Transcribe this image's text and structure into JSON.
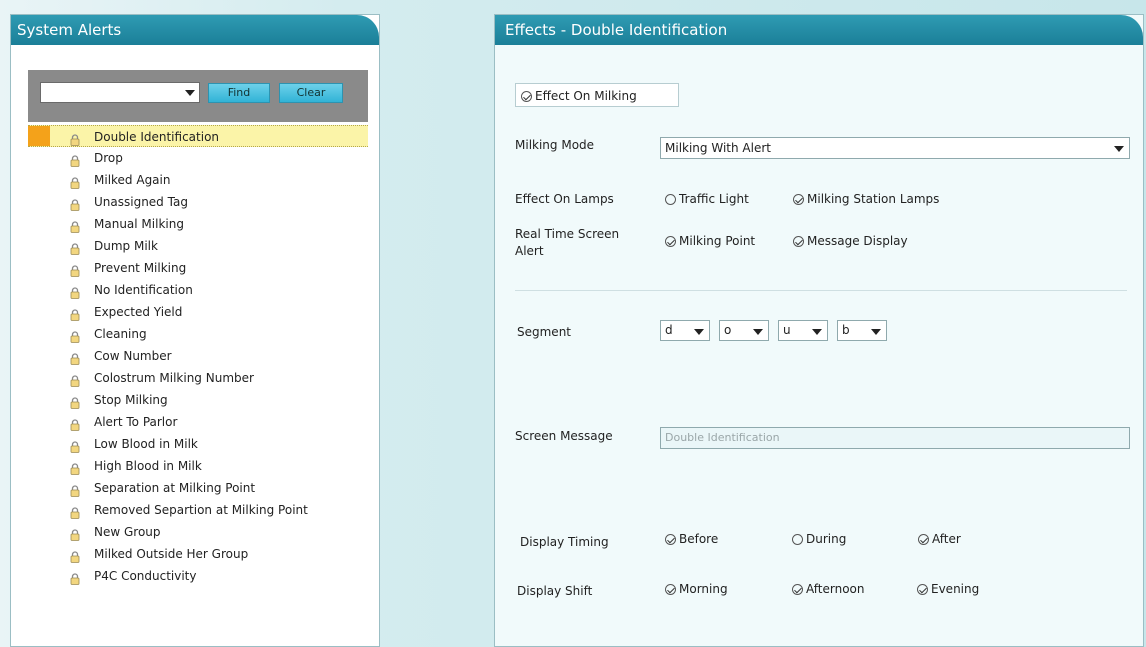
{
  "left_panel": {
    "title": "System Alerts",
    "search": {
      "value": ""
    },
    "find_label": "Find",
    "clear_label": "Clear",
    "alerts": [
      "Double Identification",
      "Drop",
      "Milked Again",
      "Unassigned Tag",
      "Manual Milking",
      "Dump Milk",
      "Prevent Milking",
      "No Identification",
      "Expected Yield",
      "Cleaning",
      "Cow Number",
      "Colostrum Milking Number",
      "Stop Milking",
      "Alert To Parlor",
      "Low Blood in Milk",
      "High Blood in Milk",
      "Separation at Milking Point",
      "Removed Separtion at Milking Point",
      "New Group",
      "Milked Outside Her Group",
      "P4C Conductivity"
    ],
    "selected_index": 0
  },
  "right_panel": {
    "title": "Effects - Double Identification",
    "effect_on_milking": {
      "label": "Effect On Milking",
      "checked": true
    },
    "milking_mode": {
      "label": "Milking Mode",
      "value": "Milking With Alert"
    },
    "effect_on_lamps": {
      "label": "Effect On Lamps",
      "traffic_light": {
        "label": "Traffic Light",
        "checked": false
      },
      "milking_station_lamps": {
        "label": "Milking Station Lamps",
        "checked": true
      }
    },
    "real_time_alert": {
      "label_line1": "Real Time Screen",
      "label_line2": "Alert",
      "milking_point": {
        "label": "Milking Point",
        "checked": true
      },
      "message_display": {
        "label": "Message Display",
        "checked": true
      }
    },
    "segment": {
      "label": "Segment",
      "values": [
        "d",
        "o",
        "u",
        "b"
      ]
    },
    "screen_message": {
      "label": "Screen Message",
      "placeholder": "Double Identification"
    },
    "display_timing": {
      "label": "Display Timing",
      "before": {
        "label": "Before",
        "checked": true
      },
      "during": {
        "label": "During",
        "checked": false
      },
      "after": {
        "label": "After",
        "checked": true
      }
    },
    "display_shift": {
      "label": "Display Shift",
      "morning": {
        "label": "Morning",
        "checked": true
      },
      "afternoon": {
        "label": "Afternoon",
        "checked": true
      },
      "evening": {
        "label": "Evening",
        "checked": true
      }
    }
  },
  "colors": {
    "header": "#1b7f98",
    "selected_row": "#fbf4a8",
    "selected_marker": "#f4a21a",
    "button": "#31b3d6"
  },
  "icons": {
    "alert_item": "lock-icon",
    "check": "check-circle-icon",
    "empty": "circle-icon"
  }
}
